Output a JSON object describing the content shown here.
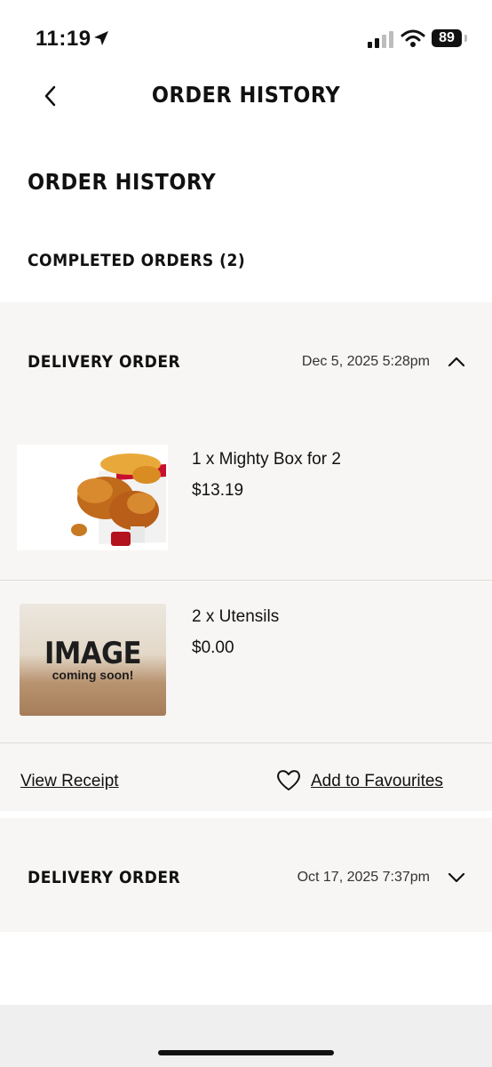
{
  "status": {
    "time": "11:19",
    "battery": "89"
  },
  "header": {
    "title": "ORDER HISTORY"
  },
  "page": {
    "heading": "ORDER HISTORY",
    "completed_label": "COMPLETED ORDERS (2)"
  },
  "orders": [
    {
      "type": "DELIVERY ORDER",
      "date": "Dec 5, 2025 5:28pm",
      "expanded": true,
      "items": [
        {
          "name": "1 x Mighty Box for 2",
          "price": "$13.19"
        },
        {
          "name": "2 x Utensils",
          "price": "$0.00",
          "image_text": "IMAGE",
          "image_subtext": "coming soon!"
        }
      ],
      "view_receipt_label": "View Receipt",
      "add_favourites_label": "Add to Favourites"
    },
    {
      "type": "DELIVERY ORDER",
      "date": "Oct 17, 2025 7:37pm",
      "expanded": false
    }
  ],
  "colors": {
    "card_bg": "#f7f6f4",
    "text": "#111111",
    "divider": "#dedcd8"
  }
}
